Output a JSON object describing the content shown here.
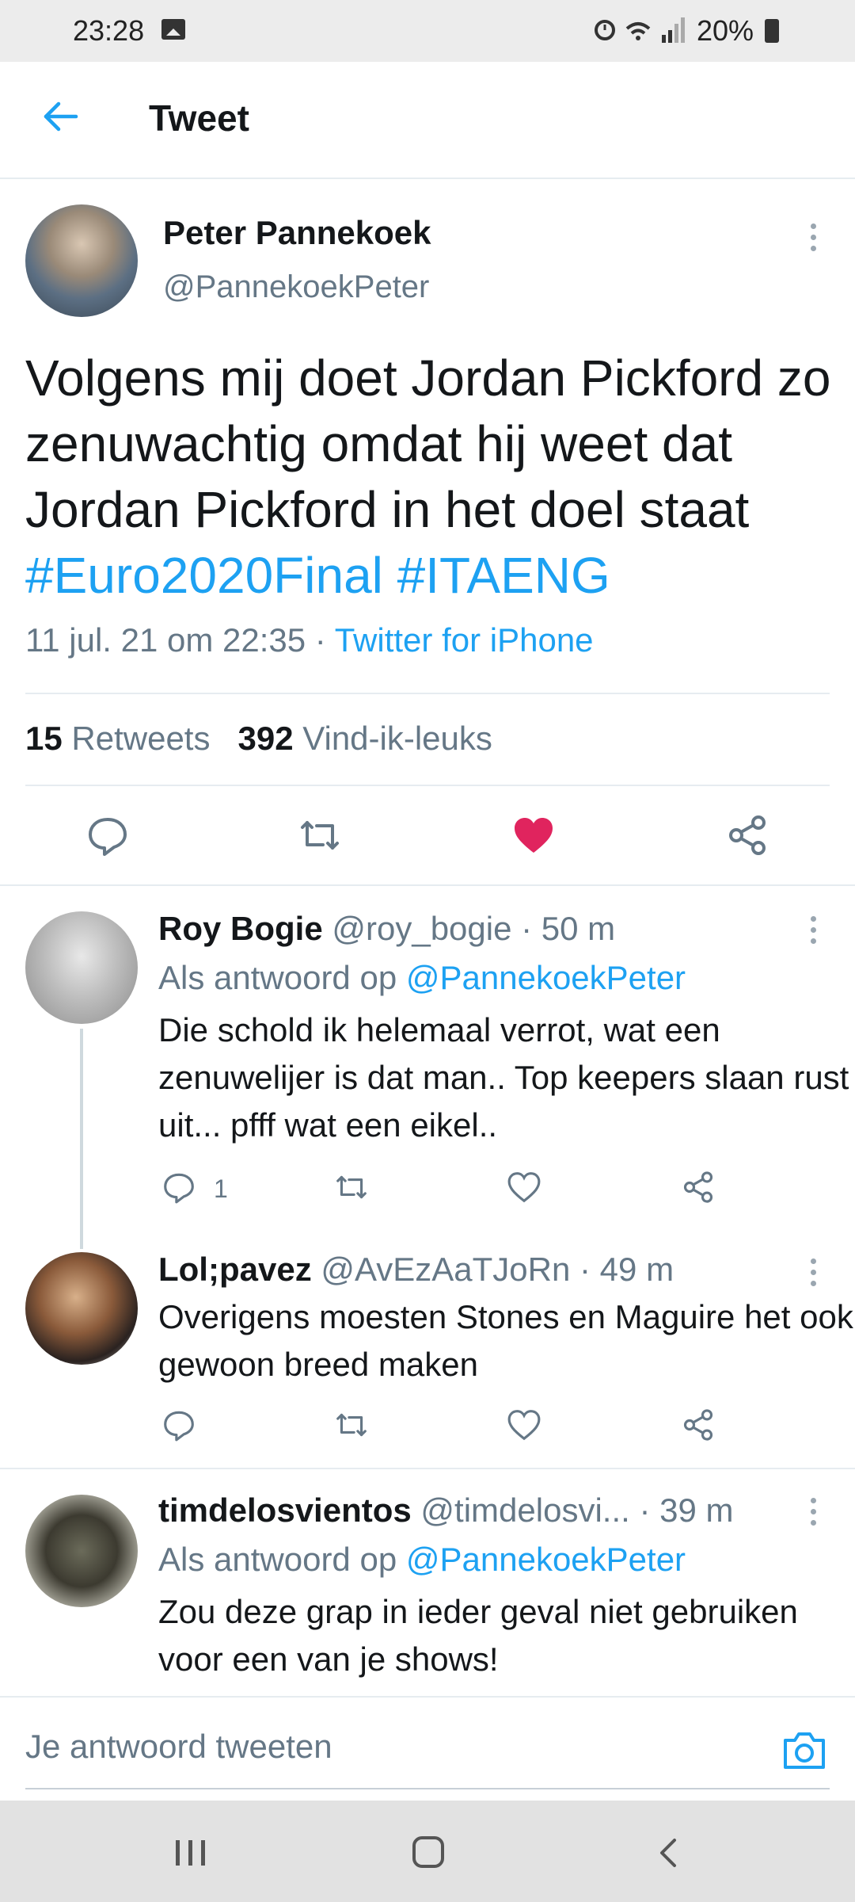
{
  "status_bar": {
    "time": "23:28",
    "battery": "20%"
  },
  "header": {
    "title": "Tweet"
  },
  "main_tweet": {
    "name": "Peter Pannekoek",
    "handle": "@PannekoekPeter",
    "text": "Volgens mij doet Jordan Pickford zo zenuwachtig omdat hij weet dat Jordan Pickford in het doel staat ",
    "hashtag1": "#Euro2020Final",
    "hashtag2": "#ITAENG",
    "timestamp": "11 jul. 21 om 22:35",
    "separator": " · ",
    "source": "Twitter for iPhone",
    "retweets_count": "15",
    "retweets_label": "Retweets",
    "likes_count": "392",
    "likes_label": "Vind-ik-leuks",
    "liked": true
  },
  "replies": [
    {
      "name": "Roy Bogie",
      "handle": "@roy_bogie",
      "time": "· 50 m",
      "reply_prefix": "Als antwoord op",
      "reply_to": "@PannekoekPeter",
      "text": "Die schold ik helemaal verrot, wat een zenuwelijer is dat man.. Top keepers slaan rust uit... pfff wat een eikel..",
      "reply_count": "1"
    },
    {
      "name": "Lol;pavez",
      "handle": "@AvEzAaTJoRn",
      "time": "· 49 m",
      "text": "Overigens moesten Stones en Maguire het ook gewoon breed maken"
    },
    {
      "name": "timdelosvientos",
      "handle": "@timdelosvi...",
      "time": "· 39 m",
      "reply_prefix": "Als antwoord op",
      "reply_to": "@PannekoekPeter",
      "text": "Zou deze grap in ieder geval niet gebruiken voor een van je shows!"
    }
  ],
  "compose": {
    "placeholder": "Je antwoord tweeten"
  },
  "colors": {
    "accent": "#1da1f2",
    "like": "#e0245e",
    "muted": "#657786",
    "text": "#14171a"
  },
  "icons": [
    "back-arrow-icon",
    "more-vertical-icon",
    "reply-icon",
    "retweet-icon",
    "heart-icon",
    "share-icon",
    "camera-icon",
    "recents-icon",
    "home-icon",
    "back-icon"
  ]
}
